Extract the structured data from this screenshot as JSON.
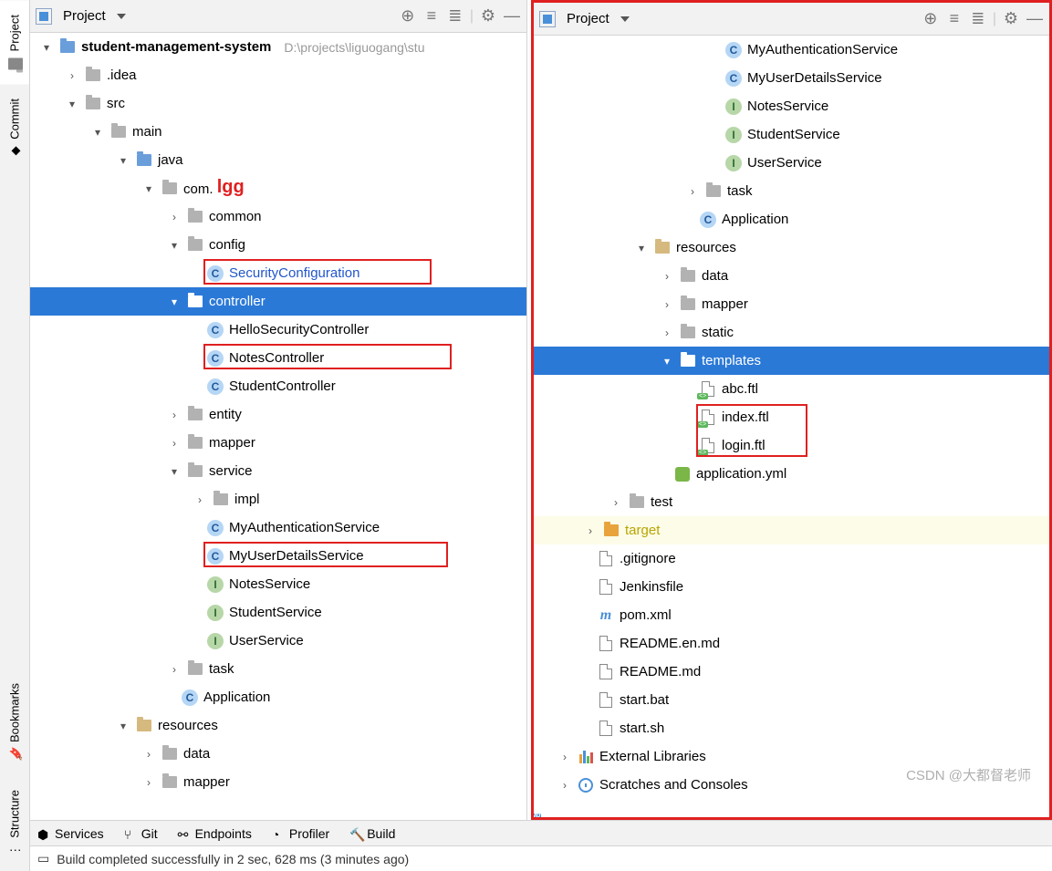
{
  "sidebar_tabs": {
    "project": "Project",
    "commit": "Commit",
    "bookmarks": "Bookmarks",
    "structure": "Structure"
  },
  "header": {
    "title": "Project"
  },
  "left_tree": {
    "root": {
      "name": "student-management-system",
      "path": "D:\\projects\\liguogang\\stu"
    },
    "idea": ".idea",
    "src": "src",
    "main": "main",
    "java": "java",
    "com": "com.",
    "com_hl": "lgg",
    "common": "common",
    "config": "config",
    "security_configuration": "SecurityConfiguration",
    "controller": "controller",
    "hello_security": "HelloSecurityController",
    "notes_ctrl": "NotesController",
    "student_ctrl": "StudentController",
    "entity": "entity",
    "mapper": "mapper",
    "service": "service",
    "impl": "impl",
    "my_auth": "MyAuthenticationService",
    "my_user": "MyUserDetailsService",
    "notes_svc": "NotesService",
    "student_svc": "StudentService",
    "user_svc": "UserService",
    "task": "task",
    "application": "Application",
    "resources": "resources",
    "data": "data",
    "mapper2": "mapper"
  },
  "right_tree": {
    "my_auth": "MyAuthenticationService",
    "my_user": "MyUserDetailsService",
    "notes_svc": "NotesService",
    "student_svc": "StudentService",
    "user_svc": "UserService",
    "task": "task",
    "application": "Application",
    "resources": "resources",
    "data": "data",
    "mapper": "mapper",
    "static": "static",
    "templates": "templates",
    "abc_ftl": "abc.ftl",
    "index_ftl": "index.ftl",
    "login_ftl": "login.ftl",
    "app_yml": "application.yml",
    "test": "test",
    "target": "target",
    "gitignore": ".gitignore",
    "jenkins": "Jenkinsfile",
    "pom": "pom.xml",
    "readme_en": "README.en.md",
    "readme": "README.md",
    "start_bat": "start.bat",
    "start_sh": "start.sh",
    "ext_libs": "External Libraries",
    "scratches": "Scratches and Consoles"
  },
  "bottom_tabs": {
    "services": "Services",
    "git": "Git",
    "endpoints": "Endpoints",
    "profiler": "Profiler",
    "build": "Build"
  },
  "status": "Build completed successfully in 2 sec, 628 ms (3 minutes ago)",
  "watermark": "CSDN @大都督老师"
}
